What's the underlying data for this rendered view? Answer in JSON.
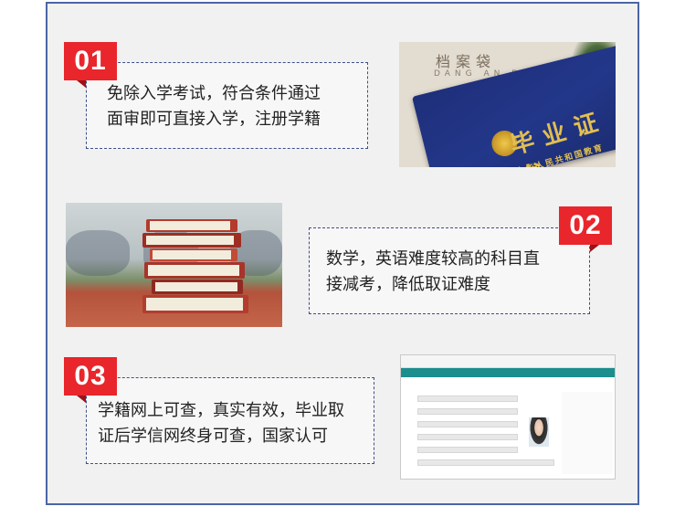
{
  "items": [
    {
      "number": "01",
      "line1": "免除入学考试，符合条件通过",
      "line2": "面审即可直接入学，注册学籍"
    },
    {
      "number": "02",
      "line1": "数学，英语难度较高的科目直",
      "line2": "接减考，降低取证难度"
    },
    {
      "number": "03",
      "line1": "学籍网上可查，真实有效，毕业取",
      "line2": "证后学信网终身可查，国家认可"
    }
  ],
  "photos": {
    "diploma": {
      "envelope_text": "档案袋",
      "envelope_sub": "DANG AN DAI",
      "cover_title": "毕业证书",
      "issuer": "中华人民共和国教育部监制"
    }
  },
  "colors": {
    "accent_red": "#e8262b",
    "frame_blue": "#4a66a6",
    "dash_blue": "#3d4f87"
  }
}
